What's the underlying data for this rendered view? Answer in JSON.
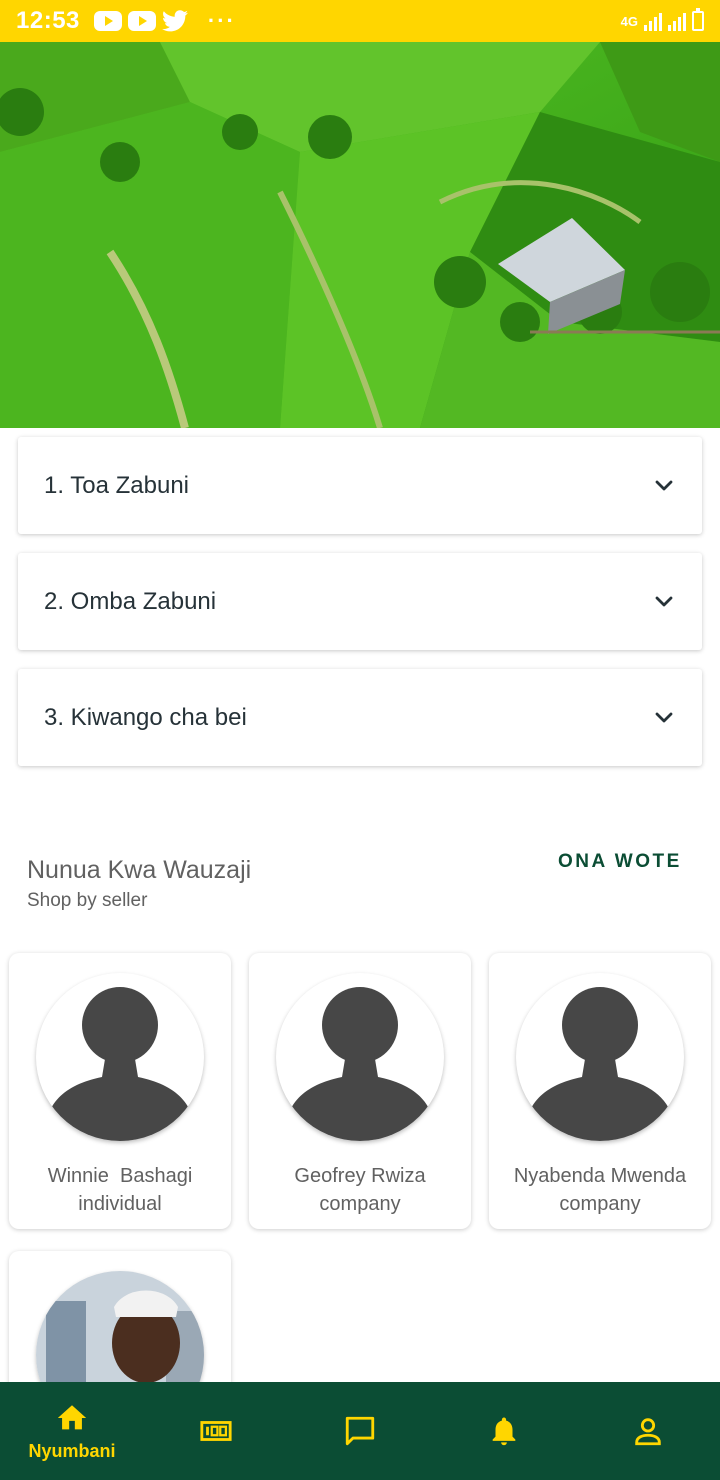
{
  "status_bar": {
    "time": "12:53",
    "network": "4G",
    "colors": {
      "bg": "#FFD600"
    }
  },
  "hero": {
    "image": "rice-terraces-photo"
  },
  "accordion": [
    {
      "label": "1. Toa Zabuni",
      "icon": "chevron-down-icon"
    },
    {
      "label": "2. Omba Zabuni",
      "icon": "chevron-down-icon"
    },
    {
      "label": "3. Kiwango cha bei",
      "icon": "chevron-down-icon"
    }
  ],
  "sellers_section": {
    "title": "Nunua Kwa Wauzaji",
    "subtitle": "Shop by seller",
    "see_all": "ONA WOTE"
  },
  "sellers": [
    {
      "name": "Winnie  Bashagi",
      "type": "individual",
      "avatar": "default-avatar-icon"
    },
    {
      "name": "Geofrey Rwiza",
      "type": "company",
      "avatar": "default-avatar-icon"
    },
    {
      "name": "Nyabenda Mwenda",
      "type": "company",
      "avatar": "default-avatar-icon"
    },
    {
      "name": "",
      "type": "",
      "avatar": "profile-photo"
    }
  ],
  "bottom_nav": [
    {
      "label": "Nyumbani",
      "icon": "home-icon",
      "active": true
    },
    {
      "label": "",
      "icon": "bids-icon",
      "active": false
    },
    {
      "label": "",
      "icon": "chat-icon",
      "active": false
    },
    {
      "label": "",
      "icon": "bell-icon",
      "active": false
    },
    {
      "label": "",
      "icon": "person-icon",
      "active": false
    }
  ],
  "colors": {
    "primary": "#0b4d34",
    "accent": "#FFD600",
    "text": "#616161"
  }
}
